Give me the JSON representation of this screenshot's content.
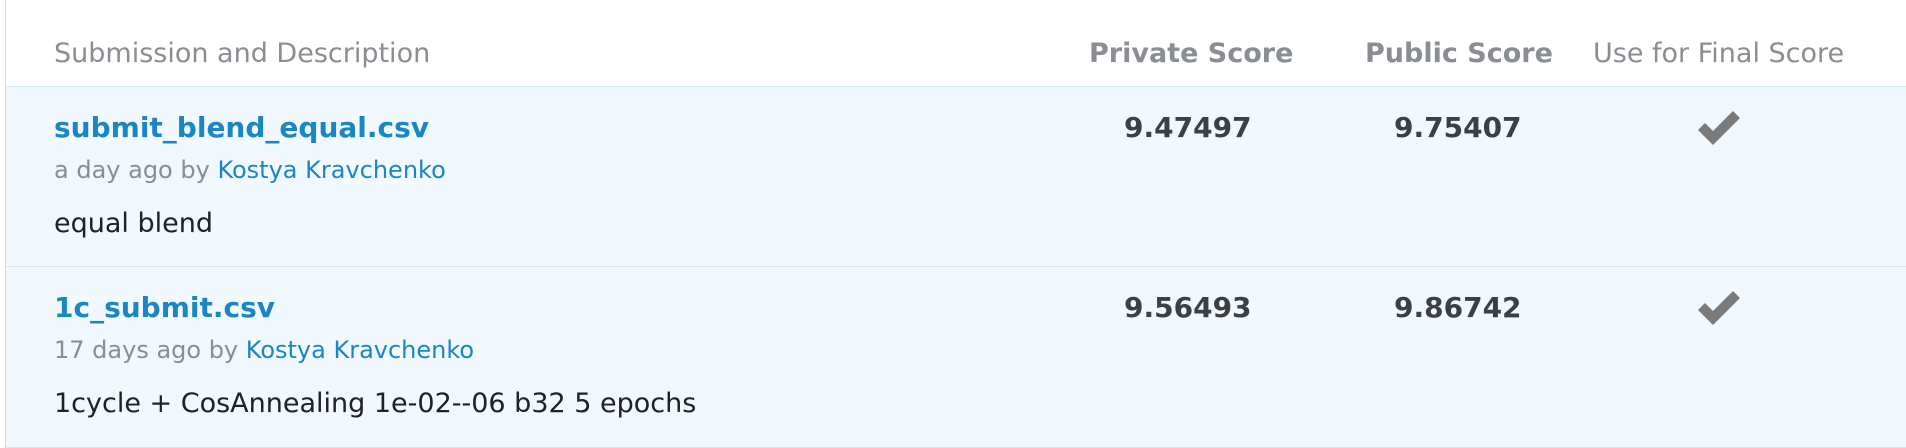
{
  "header": {
    "description_col": "Submission and Description",
    "private_col": "Private Score",
    "public_col": "Public Score",
    "final_col": "Use for Final Score"
  },
  "rows": [
    {
      "filename": "submit_blend_equal.csv",
      "when": "a day ago by",
      "author": "Kostya Kravchenko",
      "description": "equal blend",
      "private_score": "9.47497",
      "public_score": "9.75407",
      "selected_for_final": true,
      "icon": "checkmark-icon"
    },
    {
      "filename": "1c_submit.csv",
      "when": "17 days ago by",
      "author": "Kostya Kravchenko",
      "description": "1cycle + CosAnnealing 1e-02--06 b32 5 epochs",
      "private_score": "9.56493",
      "public_score": "9.86742",
      "selected_for_final": true,
      "icon": "checkmark-icon"
    }
  ],
  "colors": {
    "link": "#1a86c4",
    "muted": "#8a8d91",
    "row_bg": "#f1f8fe",
    "check": "#7a7a7a"
  }
}
